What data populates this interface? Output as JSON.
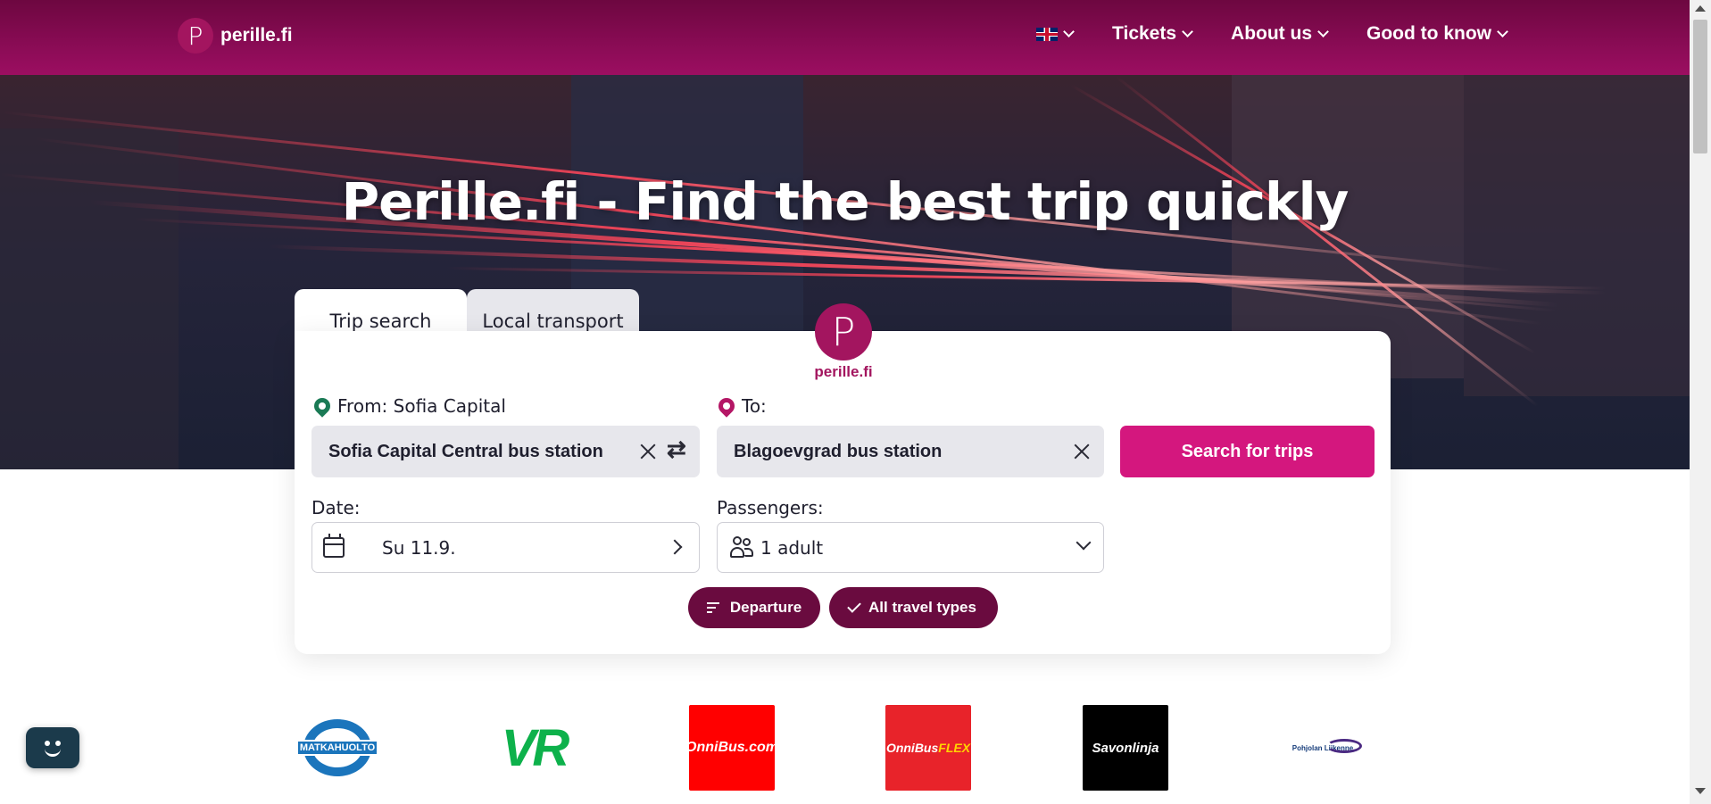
{
  "header": {
    "logo_letter": "P",
    "logo_text": "perille.fi",
    "language_flag": "uk-flag-icon",
    "nav": {
      "tickets": "Tickets",
      "about": "About us",
      "good_to_know": "Good to know"
    }
  },
  "hero": {
    "title": "Perille.fi - Find the best trip quickly"
  },
  "tabs": {
    "trip_search": "Trip search",
    "local_transport": "Local transport"
  },
  "brand": {
    "letter": "P",
    "text": "perille.fi"
  },
  "search": {
    "from_label": "From: Sofia Capital",
    "from_value": "Sofia Capital Central bus station",
    "to_label": "To:",
    "to_value": "Blagoevgrad bus station",
    "search_button": "Search for trips",
    "date_label": "Date:",
    "date_value": "Su 11.9.",
    "passengers_label": "Passengers:",
    "passengers_value": "1 adult",
    "departure_pill": "Departure",
    "travel_types_pill": "All travel types",
    "swap_icon": "⇄"
  },
  "partners": {
    "matkahuolto": "MATKAHUOLTO",
    "vr": "VR",
    "onnibus": "OnniBus.com",
    "onnibus_flex_a": "OnniBus",
    "onnibus_flex_b": "FLEX",
    "savonlinja": "Savonlinja",
    "pohjolan": "Pohjolan Liikenne"
  },
  "colors": {
    "header": "#8e0c58",
    "accent": "#d4177e",
    "pill": "#6a0b3f",
    "brand": "#a3155f"
  }
}
